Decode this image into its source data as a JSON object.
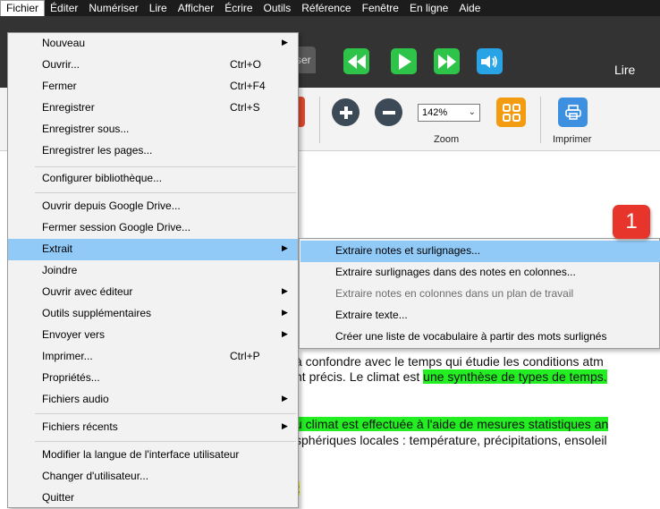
{
  "menubar": {
    "items": [
      "Fichier",
      "Éditer",
      "Numériser",
      "Lire",
      "Afficher",
      "Écrire",
      "Outils",
      "Référence",
      "Fenêtre",
      "En ligne",
      "Aide"
    ]
  },
  "toolbar": {
    "tab_fragment": "ser",
    "lire_label": "Lire",
    "zoom_value": "142%",
    "zoom_label": "Zoom",
    "print_label": "Imprimer",
    "left_label_fragment": "t"
  },
  "file_menu": {
    "items": [
      {
        "label": "Nouveau",
        "shortcut": "",
        "submenu": true
      },
      {
        "label": "Ouvrir...",
        "shortcut": "Ctrl+O",
        "submenu": false
      },
      {
        "label": "Fermer",
        "shortcut": "Ctrl+F4",
        "submenu": false
      },
      {
        "label": "Enregistrer",
        "shortcut": "Ctrl+S",
        "submenu": false
      },
      {
        "label": "Enregistrer sous...",
        "shortcut": "",
        "submenu": false
      },
      {
        "label": "Enregistrer les pages...",
        "shortcut": "",
        "submenu": false
      },
      {
        "label": "Configurer bibliothèque...",
        "shortcut": "",
        "submenu": false
      },
      {
        "label": "Ouvrir depuis Google Drive...",
        "shortcut": "",
        "submenu": false
      },
      {
        "label": "Fermer session Google Drive...",
        "shortcut": "",
        "submenu": false
      },
      {
        "label": "Extrait",
        "shortcut": "",
        "submenu": true
      },
      {
        "label": "Joindre",
        "shortcut": "",
        "submenu": false
      },
      {
        "label": "Ouvrir avec éditeur",
        "shortcut": "",
        "submenu": true
      },
      {
        "label": "Outils supplémentaires",
        "shortcut": "",
        "submenu": true
      },
      {
        "label": "Envoyer vers",
        "shortcut": "",
        "submenu": true
      },
      {
        "label": "Imprimer...",
        "shortcut": "Ctrl+P",
        "submenu": false
      },
      {
        "label": "Propriétés...",
        "shortcut": "",
        "submenu": false
      },
      {
        "label": "Fichiers audio",
        "shortcut": "",
        "submenu": true
      },
      {
        "label": "Fichiers récents",
        "shortcut": "",
        "submenu": true
      },
      {
        "label": "Modifier  la langue de l'interface utilisateur",
        "shortcut": "",
        "submenu": false
      },
      {
        "label": "Changer d'utilisateur...",
        "shortcut": "",
        "submenu": false
      },
      {
        "label": "Quitter",
        "shortcut": "",
        "submenu": false
      }
    ]
  },
  "extract_submenu": {
    "items": [
      {
        "label": "Extraire notes et surlignages...",
        "disabled": false
      },
      {
        "label": "Extraire surlignages dans des notes en colonnes...",
        "disabled": false
      },
      {
        "label": "Extraire notes en colonnes dans un plan de travail",
        "disabled": true
      },
      {
        "label": "Extraire texte...",
        "disabled": false
      },
      {
        "label": "Créer une liste de vocabulaire à partir des mots surlignés",
        "disabled": false
      }
    ]
  },
  "badge": {
    "number": "1",
    "color": "#e8352b"
  },
  "document": {
    "line1": "à confondre avec le temps qui étudie les conditions atm",
    "line2_plain": "nt précis. Le climat est ",
    "line2_highlight": "une synthèse de types de temps.",
    "line3_highlight": "u climat est effectuée à l'aide de mesures statistiques an",
    "line4": "sphériques locales : température, précipitations, ensoleil",
    "line5_highlight": "t"
  },
  "colors": {
    "green_highlight": "#22ee22",
    "yellow_highlight": "#f7f700",
    "selection": "#91c9f7",
    "nav_green": "#2ec44a",
    "nav_blue": "#27a3e6",
    "orange": "#f39c12",
    "print_blue": "#3d8fe0"
  }
}
